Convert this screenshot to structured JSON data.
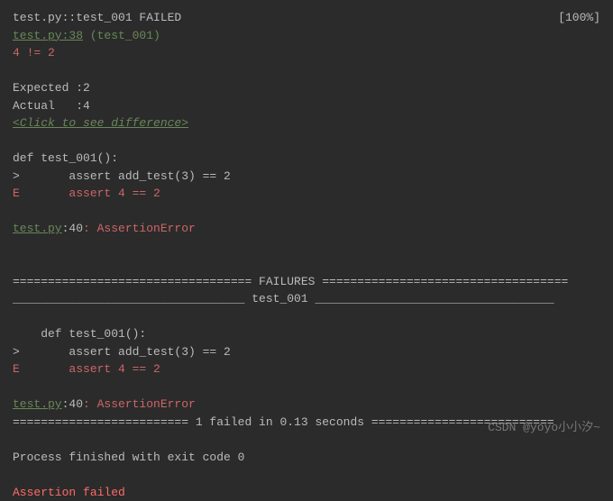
{
  "header": {
    "test_status": "test.py::test_001 FAILED",
    "progress": "[100%]"
  },
  "trace1": {
    "file_link": "test.py:38",
    "test_name": " (test_001)",
    "assertion": "4 != 2",
    "expected_label": "Expected :",
    "expected_value": "2",
    "actual_label": "Actual   :",
    "actual_value": "4",
    "diff_link": "<Click to see difference>"
  },
  "code1": {
    "def_line": "def test_001():",
    "assert_line": ">       assert add_test(3) == 2",
    "error_line": "E       assert 4 == 2"
  },
  "error1": {
    "file_link": "test.py",
    "line_no": ":40",
    "error_type": ": AssertionError"
  },
  "section": {
    "failures_header": "================================== FAILURES ===================================",
    "test_header": "_________________________________ test_001 __________________________________"
  },
  "code2": {
    "def_line": "    def test_001():",
    "assert_line": ">       assert add_test(3) == 2",
    "error_line": "E       assert 4 == 2"
  },
  "error2": {
    "file_link": "test.py",
    "line_no": ":40",
    "error_type": ": AssertionError"
  },
  "summary": {
    "line": "========================= 1 failed in 0.13 seconds ==========================",
    "exit": "Process finished with exit code 0",
    "assertion_failed": "Assertion failed"
  },
  "watermark": "CSDN @yoyo小小汐~"
}
